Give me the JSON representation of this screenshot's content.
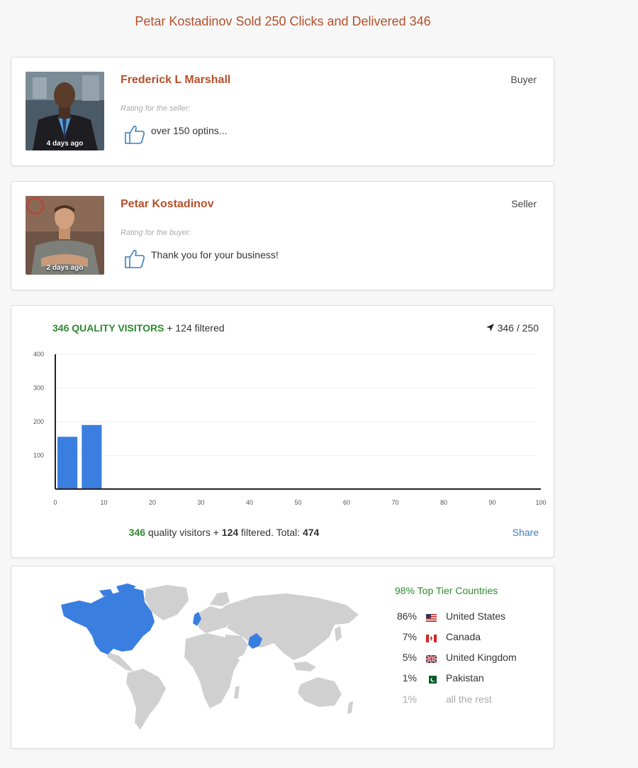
{
  "page_title": "Petar Kostadinov Sold 250 Clicks and Delivered 346",
  "reviews": [
    {
      "name": "Frederick L Marshall",
      "role": "Buyer",
      "time": "4 days ago",
      "rating_label": "Rating for the seller:",
      "text": "over 150 optins..."
    },
    {
      "name": "Petar Kostadinov",
      "role": "Seller",
      "time": "2 days ago",
      "rating_label": "Rating for the buyer:",
      "text": "Thank you for your business!"
    }
  ],
  "visitors": {
    "quality_label": "346 QUALITY VISITORS",
    "filtered_label": "+ 124 filtered",
    "count_label": "346 / 250",
    "footer": {
      "quality": "346",
      "quality_text": "quality visitors +",
      "filtered": "124",
      "filtered_text": "filtered. Total:",
      "total": "474"
    },
    "share_label": "Share"
  },
  "chart_data": {
    "type": "bar",
    "x": [
      2.5,
      7.5
    ],
    "values": [
      155,
      190
    ],
    "xlim": [
      0,
      100
    ],
    "ylim": [
      0,
      400
    ],
    "x_ticks": [
      "0",
      "10",
      "20",
      "30",
      "40",
      "50",
      "60",
      "70",
      "80",
      "90",
      "100"
    ],
    "y_ticks": [
      "100",
      "200",
      "300",
      "400"
    ],
    "bar_color": "#3a7ee0",
    "grid": true
  },
  "geo": {
    "title": "98% Top Tier Countries",
    "countries": [
      {
        "pct": "86%",
        "name": "United States",
        "flag": "us-flag-icon"
      },
      {
        "pct": "7%",
        "name": "Canada",
        "flag": "canada-flag-icon"
      },
      {
        "pct": "5%",
        "name": "United Kingdom",
        "flag": "uk-flag-icon"
      },
      {
        "pct": "1%",
        "name": "Pakistan",
        "flag": "pakistan-flag-icon"
      }
    ],
    "rest": {
      "pct": "1%",
      "name": "all the rest"
    },
    "highlight_color": "#3a7ee0",
    "land_color": "#d0d0d0"
  }
}
